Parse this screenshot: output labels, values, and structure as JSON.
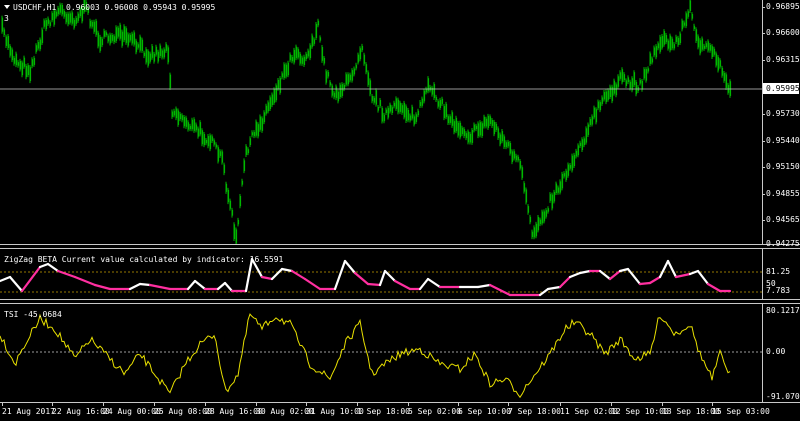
{
  "main": {
    "symbol_title": "USDCHF,H1",
    "ohlc": "0.96003 0.96008 0.95943 0.95995",
    "corner_label": "3",
    "price_labels": [
      "0.96895",
      "0.96600",
      "0.96315",
      "0.95995",
      "0.95730",
      "0.95440",
      "0.95150",
      "0.94855",
      "0.94565",
      "0.94275"
    ],
    "current_price": "0.95995"
  },
  "zigzag": {
    "title": "ZigZag BETA  Current value calculated by indicator: 16.5591",
    "levels": [
      "81.25",
      "50",
      "7.783"
    ]
  },
  "tsi": {
    "title": "TSI -45.0684",
    "levels": [
      "80.1217",
      "0.00",
      "-91.0701"
    ]
  },
  "time_labels": [
    "21 Aug 2017",
    "22 Aug 16:00",
    "24 Aug 00:00",
    "25 Aug 08:00",
    "28 Aug 16:00",
    "30 Aug 02:00",
    "31 Aug 10:00",
    "1 Sep 18:00",
    "5 Sep 02:00",
    "6 Sep 10:00",
    "7 Sep 18:00",
    "11 Sep 02:00",
    "12 Sep 10:00",
    "13 Sep 18:00",
    "15 Sep 03:00"
  ],
  "colors": {
    "candles": "#00b800",
    "zigzag_up": "#ffffff",
    "zigzag_down": "#ff2fa0",
    "tsi": "#e8e000",
    "level_line": "#c8a000"
  }
}
